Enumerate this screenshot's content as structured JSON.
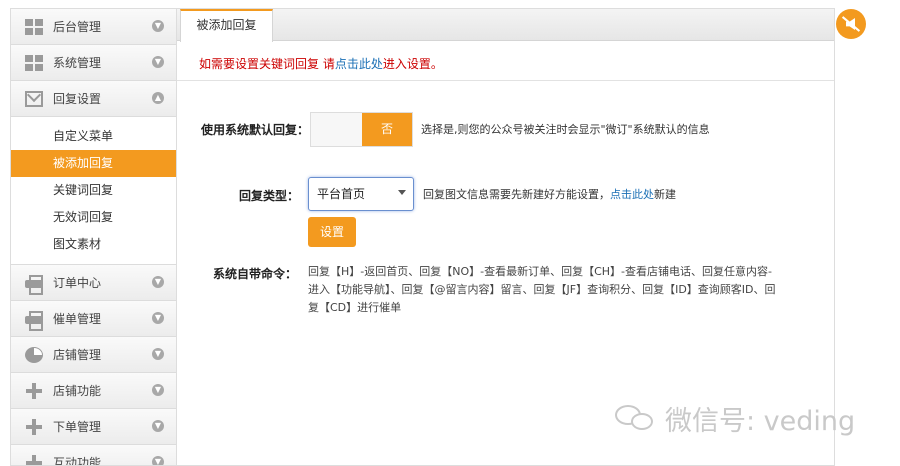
{
  "sidebar": {
    "items": [
      {
        "label": "后台管理",
        "icon": "grid-icon"
      },
      {
        "label": "系统管理",
        "icon": "grid-icon"
      },
      {
        "label": "回复设置",
        "icon": "mail-icon"
      },
      {
        "label": "订单中心",
        "icon": "printer-icon"
      },
      {
        "label": "催单管理",
        "icon": "printer-icon"
      },
      {
        "label": "店铺管理",
        "icon": "pie-icon"
      },
      {
        "label": "店铺功能",
        "icon": "plus-icon"
      },
      {
        "label": "下单管理",
        "icon": "plus-icon"
      },
      {
        "label": "互动功能",
        "icon": "plus-icon"
      }
    ],
    "sub_items": [
      {
        "label": "自定义菜单"
      },
      {
        "label": "被添加回复",
        "active": true
      },
      {
        "label": "关键词回复"
      },
      {
        "label": "无效词回复"
      },
      {
        "label": "图文素材"
      }
    ]
  },
  "main": {
    "tab_label": "被添加回复",
    "notice": {
      "prefix": "如需要设置关键词回复 请",
      "link": "点击此处",
      "suffix": "进入设置。"
    },
    "default_reply": {
      "label": "使用系统默认回复：",
      "toggle_value": "否",
      "description": "选择是,则您的公众号被关注时会显示\"微订\"系统默认的信息"
    },
    "reply_type": {
      "label": "回复类型：",
      "selected": "平台首页",
      "desc_prefix": "回复图文信息需要先新建好方能设置，",
      "desc_link": "点击此处",
      "desc_suffix": "新建",
      "set_button": "设置"
    },
    "commands": {
      "label": "系统自带命令：",
      "text": "回复【H】-返回首页、回复【NO】-查看最新订单、回复【CH】-查看店铺电话、回复任意内容-进入【功能导航】、回复【@留言内容】留言、回复【JF】查询积分、回复【ID】查询顾客ID、回复【CD】进行催单"
    }
  },
  "watermark": {
    "text": "微信号: veding"
  },
  "colors": {
    "accent": "#f39a1f",
    "link": "#1a6fb5",
    "notice": "#cc0000"
  }
}
